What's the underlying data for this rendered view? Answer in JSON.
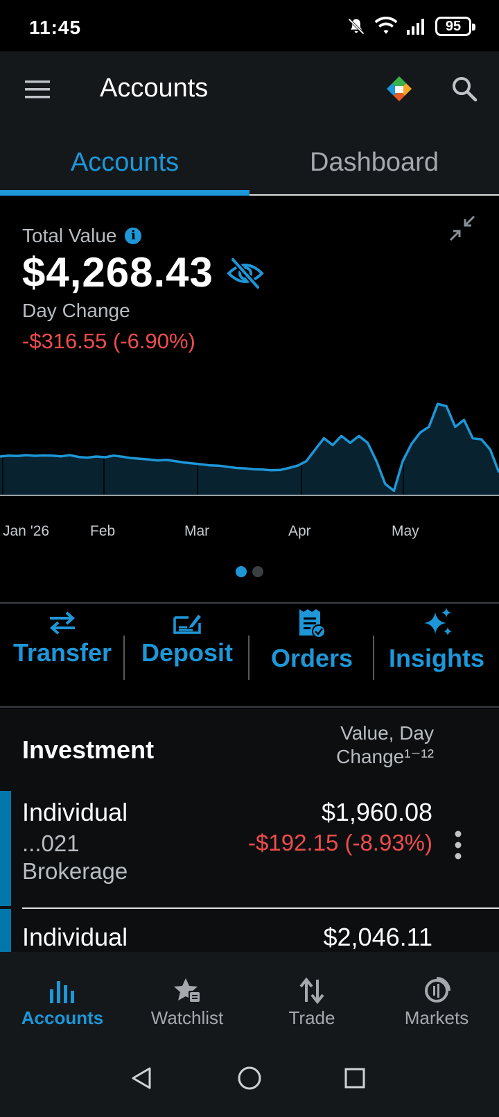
{
  "status": {
    "time": "11:45",
    "battery": "95"
  },
  "app_bar": {
    "title": "Accounts"
  },
  "tabs": [
    {
      "label": "Accounts",
      "active": true
    },
    {
      "label": "Dashboard",
      "active": false
    }
  ],
  "summary": {
    "total_value_label": "Total Value",
    "total_value": "$4,268.43",
    "day_change_label": "Day Change",
    "day_change": "-$316.55 (-6.90%)"
  },
  "chart_data": {
    "type": "area",
    "x_tick_labels": [
      "Jan '26",
      "Feb",
      "Mar",
      "Apr",
      "May"
    ],
    "values": [
      4640,
      4648,
      4644,
      4652,
      4646,
      4650,
      4648,
      4642,
      4652,
      4636,
      4630,
      4640,
      4634,
      4648,
      4638,
      4626,
      4620,
      4614,
      4606,
      4610,
      4600,
      4588,
      4580,
      4572,
      4562,
      4560,
      4550,
      4540,
      4536,
      4528,
      4526,
      4520,
      4522,
      4540,
      4560,
      4600,
      4700,
      4800,
      4740,
      4820,
      4760,
      4820,
      4760,
      4600,
      4400,
      4340,
      4600,
      4750,
      4850,
      4900,
      5100,
      5080,
      4900,
      4960,
      4800,
      4790,
      4700,
      4500
    ],
    "colors": {
      "line": "#1d97d8",
      "fill": "#082230"
    }
  },
  "actions": [
    {
      "label": "Transfer",
      "icon": "transfer-icon"
    },
    {
      "label": "Deposit",
      "icon": "deposit-icon"
    },
    {
      "label": "Orders",
      "icon": "orders-icon"
    },
    {
      "label": "Insights",
      "icon": "sparkle-icon"
    }
  ],
  "investment": {
    "title": "Investment",
    "column_header_line1": "Value, Day",
    "column_header_line2": "Change¹⁻¹²",
    "accounts": [
      {
        "name": "Individual",
        "number": "...021",
        "type": "Brokerage",
        "value": "$1,960.08",
        "change": "-$192.15 (-8.93%)"
      },
      {
        "name": "Individual",
        "number": "",
        "type": "",
        "value": "$2,046.11",
        "change": ""
      }
    ]
  },
  "bottom_nav": [
    {
      "label": "Accounts",
      "active": true
    },
    {
      "label": "Watchlist",
      "active": false
    },
    {
      "label": "Trade",
      "active": false
    },
    {
      "label": "Markets",
      "active": false
    }
  ],
  "colors": {
    "accent": "#1d97d8",
    "negative": "#ef4c4c",
    "app_bar": "#15181b"
  }
}
